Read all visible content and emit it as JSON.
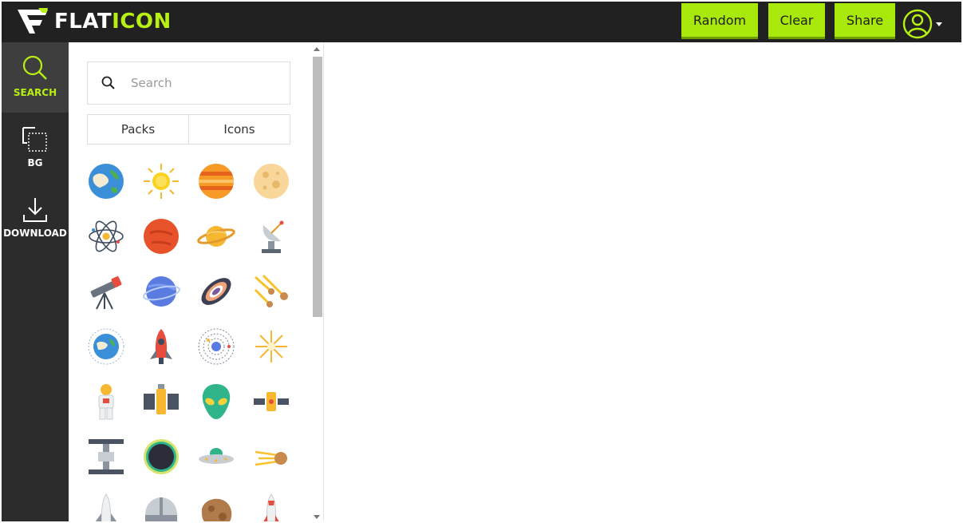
{
  "app": {
    "logo_text_white": "FLAT",
    "logo_text_green": "ICON",
    "accent": "#a8e80a",
    "topbar_bg": "#212121"
  },
  "toolbar": {
    "random_label": "Random",
    "clear_label": "Clear",
    "share_label": "Share",
    "user_icon": "user-circle-icon"
  },
  "sidebar": {
    "items": [
      {
        "label": "SEARCH",
        "icon": "search-icon",
        "active": true
      },
      {
        "label": "BG",
        "icon": "background-icon",
        "active": false
      },
      {
        "label": "DOWNLOAD",
        "icon": "download-icon",
        "active": false
      }
    ]
  },
  "panel": {
    "search_placeholder": "Search",
    "search_value": "",
    "tabs": [
      {
        "label": "Packs"
      },
      {
        "label": "Icons"
      }
    ],
    "icons": [
      "earth-icon",
      "sun-icon",
      "jupiter-icon",
      "moon-icon",
      "atom-icon",
      "mars-icon",
      "saturn-icon",
      "satellite-dish-icon",
      "telescope-icon",
      "neptune-icon",
      "galaxy-icon",
      "meteor-shower-icon",
      "earth-orbit-icon",
      "rocket-icon",
      "solar-system-icon",
      "star-burst-icon",
      "astronaut-icon",
      "space-station-module-icon",
      "alien-icon",
      "satellite-icon",
      "space-station-icon",
      "black-hole-icon",
      "ufo-icon",
      "comet-icon",
      "space-shuttle-icon",
      "observatory-icon",
      "asteroid-icon",
      "launch-rocket-icon"
    ]
  }
}
